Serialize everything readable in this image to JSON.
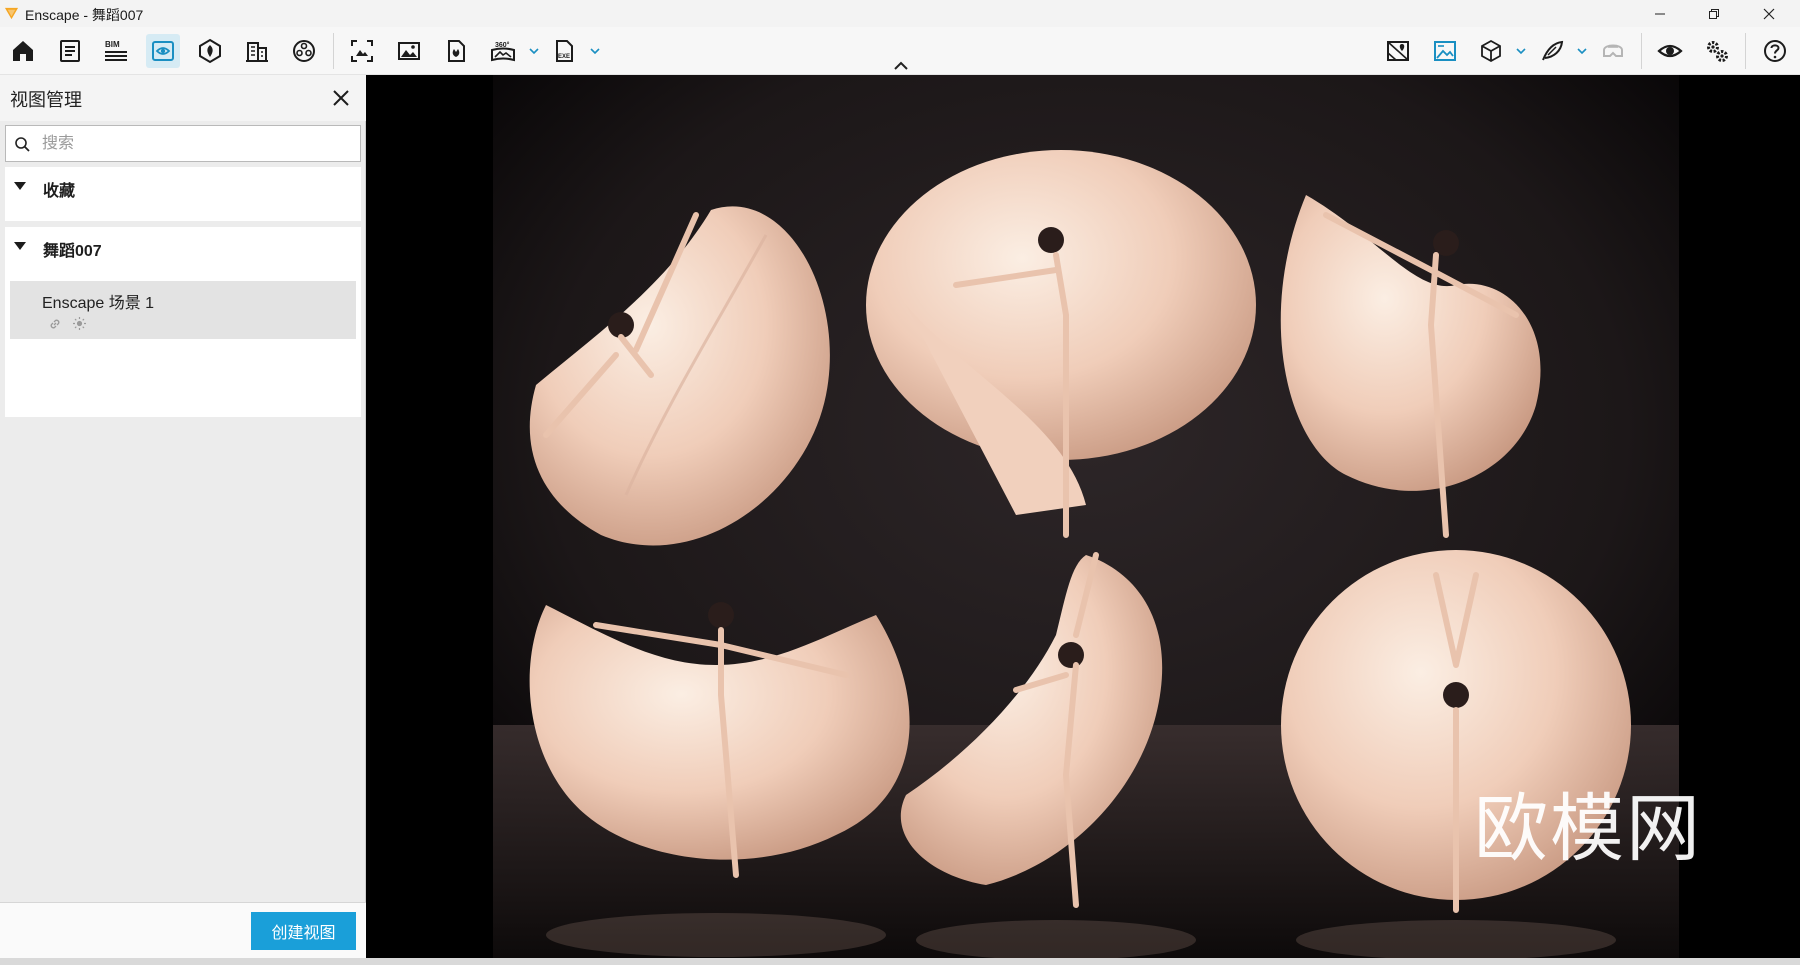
{
  "window": {
    "title": "Enscape - 舞蹈007",
    "controls": [
      "minimize",
      "restore",
      "close"
    ]
  },
  "toolbar": {
    "left_icons": [
      "home-icon",
      "document-icon",
      "bim-icon",
      "view-management-icon",
      "asset-library-icon",
      "building-icon",
      "material-icon",
      "screenshot-icon",
      "image-icon",
      "batch-render-icon",
      "panorama-360-icon",
      "export-exe-icon"
    ],
    "right_icons": [
      "map-icon",
      "visual-settings-icon",
      "box-icon",
      "feather-icon",
      "vr-headset-icon",
      "eye-icon",
      "settings-icon",
      "help-icon"
    ],
    "bim_label": "BIM",
    "pano_label": "360°",
    "exe_label": "EXE",
    "active": "view-management-icon",
    "accent": "#1a9fd9"
  },
  "panel": {
    "title": "视图管理",
    "search_placeholder": "搜索",
    "sections": [
      {
        "label": "收藏",
        "expanded": true,
        "items": []
      },
      {
        "label": "舞蹈007",
        "expanded": true,
        "items": [
          {
            "name": "Enscape 场景 1",
            "icons": [
              "link-icon",
              "sun-icon"
            ]
          }
        ]
      }
    ],
    "create_button": "创建视图"
  },
  "viewport": {
    "brand_watermark": "欧模网",
    "background": "#000000",
    "dress_color": "#f2d7c7"
  }
}
